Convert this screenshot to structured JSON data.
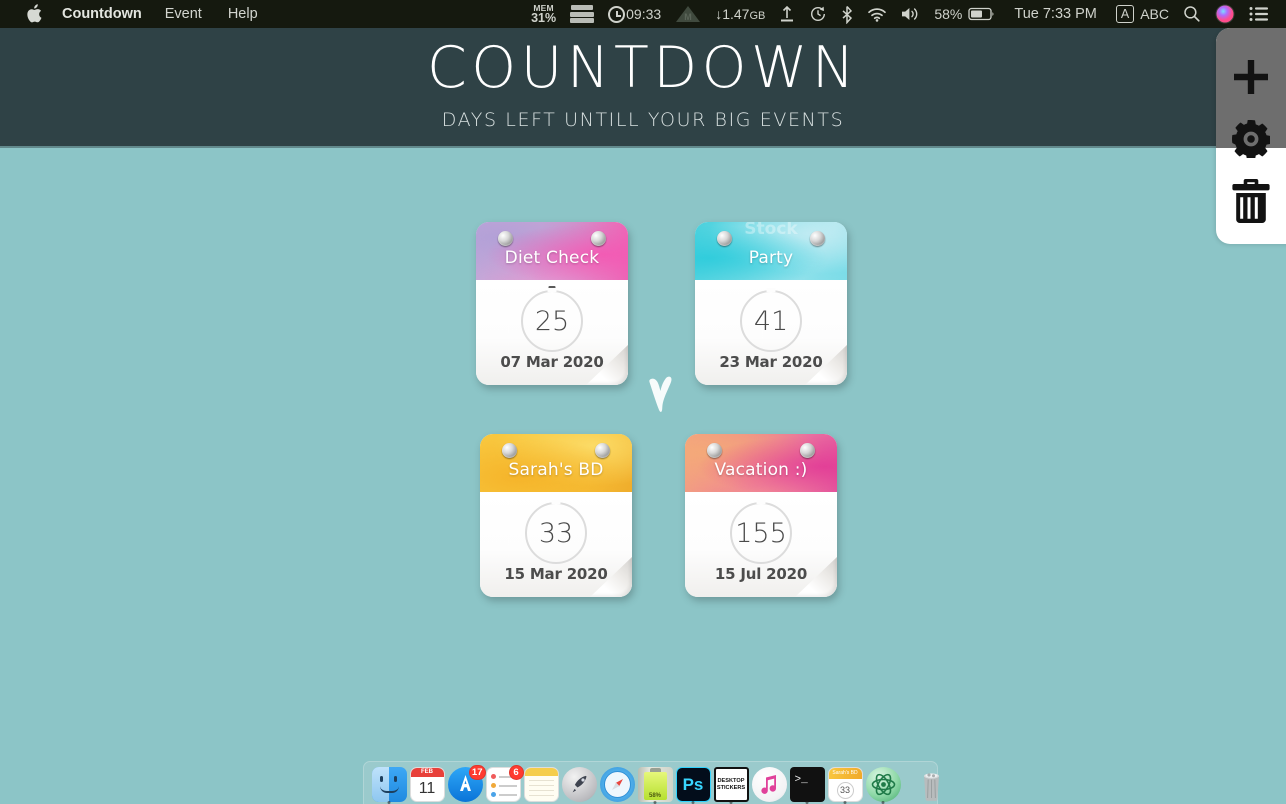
{
  "menubar": {
    "apple_icon": "apple-logo",
    "app_menus": [
      {
        "label": "Countdown",
        "bold": true
      },
      {
        "label": "Event",
        "bold": false
      },
      {
        "label": "Help",
        "bold": false
      }
    ],
    "status": {
      "mem_label": "MEM",
      "mem_value": "31%",
      "disk_icon": "disk-stack-icon",
      "clock_icon": "clock-icon",
      "uptime": "09:33",
      "mountain_icon": "mountain-icon",
      "network_down": "↓1.47",
      "network_unit": "GB",
      "upload_icon": "upload-icon",
      "timemachine_icon": "time-machine-icon",
      "bluetooth_icon": "bluetooth-icon",
      "wifi_icon": "wifi-icon",
      "volume_icon": "volume-icon",
      "battery_percent": "58%",
      "battery_icon": "battery-icon",
      "datetime": "Tue 7:33 PM",
      "input_source_badge": "A",
      "input_source": "ABC",
      "search_icon": "search-icon",
      "siri_icon": "siri-icon",
      "notification_center_icon": "notification-center-icon"
    }
  },
  "header": {
    "title": "COUNTDOWN",
    "subtitle": "DAYS LEFT UNTILL YOUR BIG EVENTS",
    "bg_color": "#2F4246"
  },
  "toolbar": {
    "add_label": "add-event",
    "settings_label": "settings",
    "delete_label": "delete-event"
  },
  "desktop": {
    "bg_color": "#8CC5C7",
    "decoration": "white-heart"
  },
  "events": [
    {
      "title": "Diet Check",
      "days": "25",
      "date": "07 Mar 2020",
      "color_from": "#b9a7d6",
      "color_mid": "#cf9fd0",
      "color_to": "#ef5fb5",
      "watermark": ""
    },
    {
      "title": "Party",
      "days": "41",
      "date": "23 Mar 2020",
      "color_from": "#3fcfdc",
      "color_mid": "#7fdce4",
      "color_to": "#b6e8ef",
      "watermark": "Stock"
    },
    {
      "title": "Sarah's BD",
      "days": "33",
      "date": "15 Mar 2020",
      "color_from": "#f8c23a",
      "color_mid": "#f6c83f",
      "color_to": "#f0a92a",
      "watermark": ""
    },
    {
      "title": "Vacation :)",
      "days": "155",
      "date": "15 Jul 2020",
      "color_from": "#f2a07c",
      "color_mid": "#ef8b94",
      "color_to": "#e4559b",
      "watermark": ""
    }
  ],
  "dock": {
    "items": [
      {
        "name": "finder",
        "label": "Finder",
        "badge": "",
        "running": true
      },
      {
        "name": "calendar",
        "label": "Calendar",
        "month": "FEB",
        "day": "11",
        "badge": "",
        "running": false
      },
      {
        "name": "app-store",
        "label": "App Store",
        "badge": "17",
        "running": false
      },
      {
        "name": "reminders",
        "label": "Reminders",
        "badge": "6",
        "running": false
      },
      {
        "name": "notes",
        "label": "Notes",
        "badge": "",
        "running": false
      },
      {
        "name": "launchpad",
        "label": "Launchpad",
        "badge": "",
        "running": false
      },
      {
        "name": "safari",
        "label": "Safari",
        "badge": "",
        "running": false
      },
      {
        "name": "battery-monitor",
        "label": "Battery Monitor",
        "badge": "",
        "running": true
      },
      {
        "name": "photoshop",
        "label": "Ps",
        "badge": "",
        "running": true
      },
      {
        "name": "desktop-stickers",
        "label": "DESKTOP STICKERS",
        "badge": "",
        "running": true
      },
      {
        "name": "itunes",
        "label": "iTunes",
        "badge": "",
        "running": false
      },
      {
        "name": "terminal",
        "label": "Terminal",
        "badge": "",
        "running": true
      },
      {
        "name": "countdown",
        "label": "Countdown",
        "card_title": "Sarah's BD",
        "card_days": "33",
        "badge": "",
        "running": true
      },
      {
        "name": "atom",
        "label": "Atom",
        "badge": "",
        "running": true
      },
      {
        "name": "trash",
        "label": "Trash",
        "badge": "",
        "running": false
      }
    ]
  }
}
